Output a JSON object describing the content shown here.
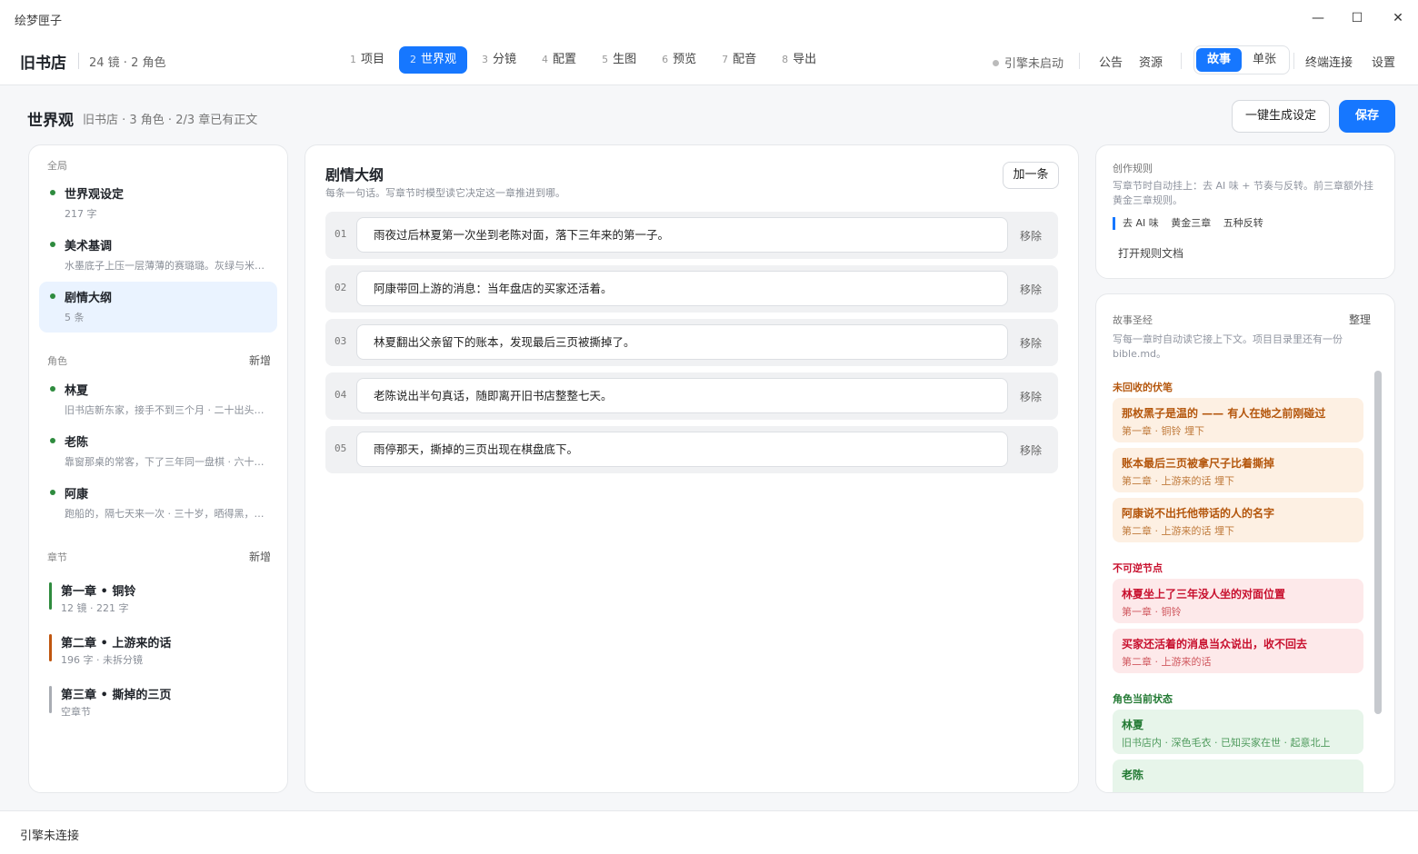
{
  "app": {
    "title": "绘梦匣子"
  },
  "window": {
    "minimize": "—",
    "maximize": "☐",
    "close": "✕"
  },
  "project": {
    "name": "旧书店",
    "meta": "24 镜 · 2 角色"
  },
  "steps": [
    {
      "n": "1",
      "label": "项目"
    },
    {
      "n": "2",
      "label": "世界观"
    },
    {
      "n": "3",
      "label": "分镜"
    },
    {
      "n": "4",
      "label": "配置"
    },
    {
      "n": "5",
      "label": "生图"
    },
    {
      "n": "6",
      "label": "预览"
    },
    {
      "n": "7",
      "label": "配音"
    },
    {
      "n": "8",
      "label": "导出"
    }
  ],
  "active_step": 1,
  "topbar": {
    "engine_status": "引擎未启动",
    "announce": "公告",
    "resources": "资源",
    "mode_story": "故事",
    "mode_single": "单张",
    "terminal": "终端连接",
    "settings": "设置"
  },
  "page": {
    "title": "世界观",
    "meta": "旧书店 · 3 角色 · 2/3 章已有正文",
    "gen_button": "一键生成设定",
    "save_button": "保存"
  },
  "sidebar": {
    "global_label": "全局",
    "global_items": [
      {
        "name": "世界观设定",
        "sub": "217 字"
      },
      {
        "name": "美术基调",
        "sub": "水墨底子上压一层薄薄的赛璐璐。灰绿与米黄为主调，夜景偏冷"
      },
      {
        "name": "剧情大纲",
        "sub": "5 条"
      }
    ],
    "roles_label": "角色",
    "roles_add": "新增",
    "roles": [
      {
        "name": "林夏",
        "sub": "旧书店新东家，接手不到三个月 · 二十出头，安静，记性好"
      },
      {
        "name": "老陈",
        "sub": "靠窗那桌的常客，下了三年同一盘棋 · 六十来岁，话少"
      },
      {
        "name": "阿康",
        "sub": "跑船的，隔七天来一次 · 三十岁，晒得黑，嗓门大"
      }
    ],
    "chapters_label": "章节",
    "chapters_add": "新增",
    "chapters": [
      {
        "name": "第一章 • 铜铃",
        "sub": "12 镜 · 221 字",
        "color": "#2e8b3e"
      },
      {
        "name": "第二章 • 上游来的话",
        "sub": "196 字 · 未拆分镜",
        "color": "#c0560f"
      },
      {
        "name": "第三章 • 撕掉的三页",
        "sub": "空章节",
        "color": "#a8acb3"
      }
    ]
  },
  "outline": {
    "title": "剧情大纲",
    "subtitle": "每条一句话。写章节时模型读它决定这一章推进到哪。",
    "add_button": "加一条",
    "remove_label": "移除",
    "rows": [
      {
        "num": "01",
        "text": "雨夜过后林夏第一次坐到老陈对面，落下三年来的第一子。"
      },
      {
        "num": "02",
        "text": "阿康带回上游的消息：当年盘店的买家还活着。"
      },
      {
        "num": "03",
        "text": "林夏翻出父亲留下的账本，发现最后三页被撕掉了。"
      },
      {
        "num": "04",
        "text": "老陈说出半句真话，随即离开旧书店整整七天。"
      },
      {
        "num": "05",
        "text": "雨停那天，撕掉的三页出现在棋盘底下。"
      }
    ]
  },
  "rules": {
    "label": "创作规则",
    "desc": "写章节时自动挂上：去 AI 味 + 节奏与反转。前三章额外挂黄金三章规则。",
    "tags": [
      "去 AI 味",
      "黄金三章",
      "五种反转"
    ],
    "open_doc": "打开规则文档"
  },
  "bible": {
    "label": "故事圣经",
    "tidy": "整理",
    "desc": "写每一章时自动读它接上下文。项目目录里还有一份 bible.md。",
    "foreshadow_label": "未回收的伏笔",
    "foreshadow": [
      {
        "title": "那枚黑子是温的 —— 有人在她之前刚碰过",
        "sub": "第一章 · 铜铃 埋下"
      },
      {
        "title": "账本最后三页被拿尺子比着撕掉",
        "sub": "第二章 · 上游来的话 埋下"
      },
      {
        "title": "阿康说不出托他带话的人的名字",
        "sub": "第二章 · 上游来的话 埋下"
      }
    ],
    "irreversible_label": "不可逆节点",
    "irreversible": [
      {
        "title": "林夏坐上了三年没人坐的对面位置",
        "sub": "第一章 · 铜铃"
      },
      {
        "title": "买家还活着的消息当众说出，收不回去",
        "sub": "第二章 · 上游来的话"
      }
    ],
    "roles_state_label": "角色当前状态",
    "roles_state": [
      {
        "title": "林夏",
        "sub": "旧书店内 · 深色毛衣 · 已知买家在世 · 起意北上"
      },
      {
        "title": "老陈",
        "sub": ""
      }
    ]
  },
  "statusbar": {
    "text": "引擎未连接"
  },
  "colors": {
    "accent": "#1677ff",
    "foreshadow": "#b4560c",
    "irreversible": "#c8102e",
    "role_state": "#237a34"
  }
}
